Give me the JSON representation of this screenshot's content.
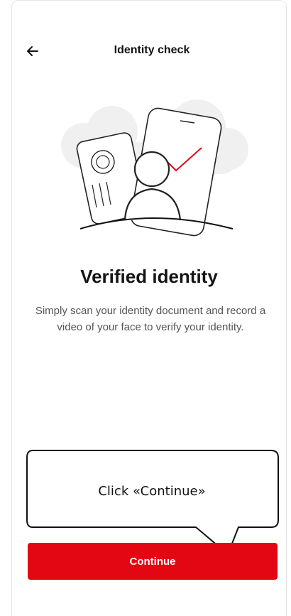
{
  "header": {
    "title": "Identity check"
  },
  "main": {
    "heading": "Verified identity",
    "description": "Simply scan your identity document and record a video of your face to verify your identity."
  },
  "tooltip": {
    "text": "Click «Continue»"
  },
  "actions": {
    "continue_label": "Continue"
  },
  "colors": {
    "accent": "#e30613",
    "check_mark": "#e30613"
  },
  "icons": {
    "back": "arrow-left-icon"
  }
}
